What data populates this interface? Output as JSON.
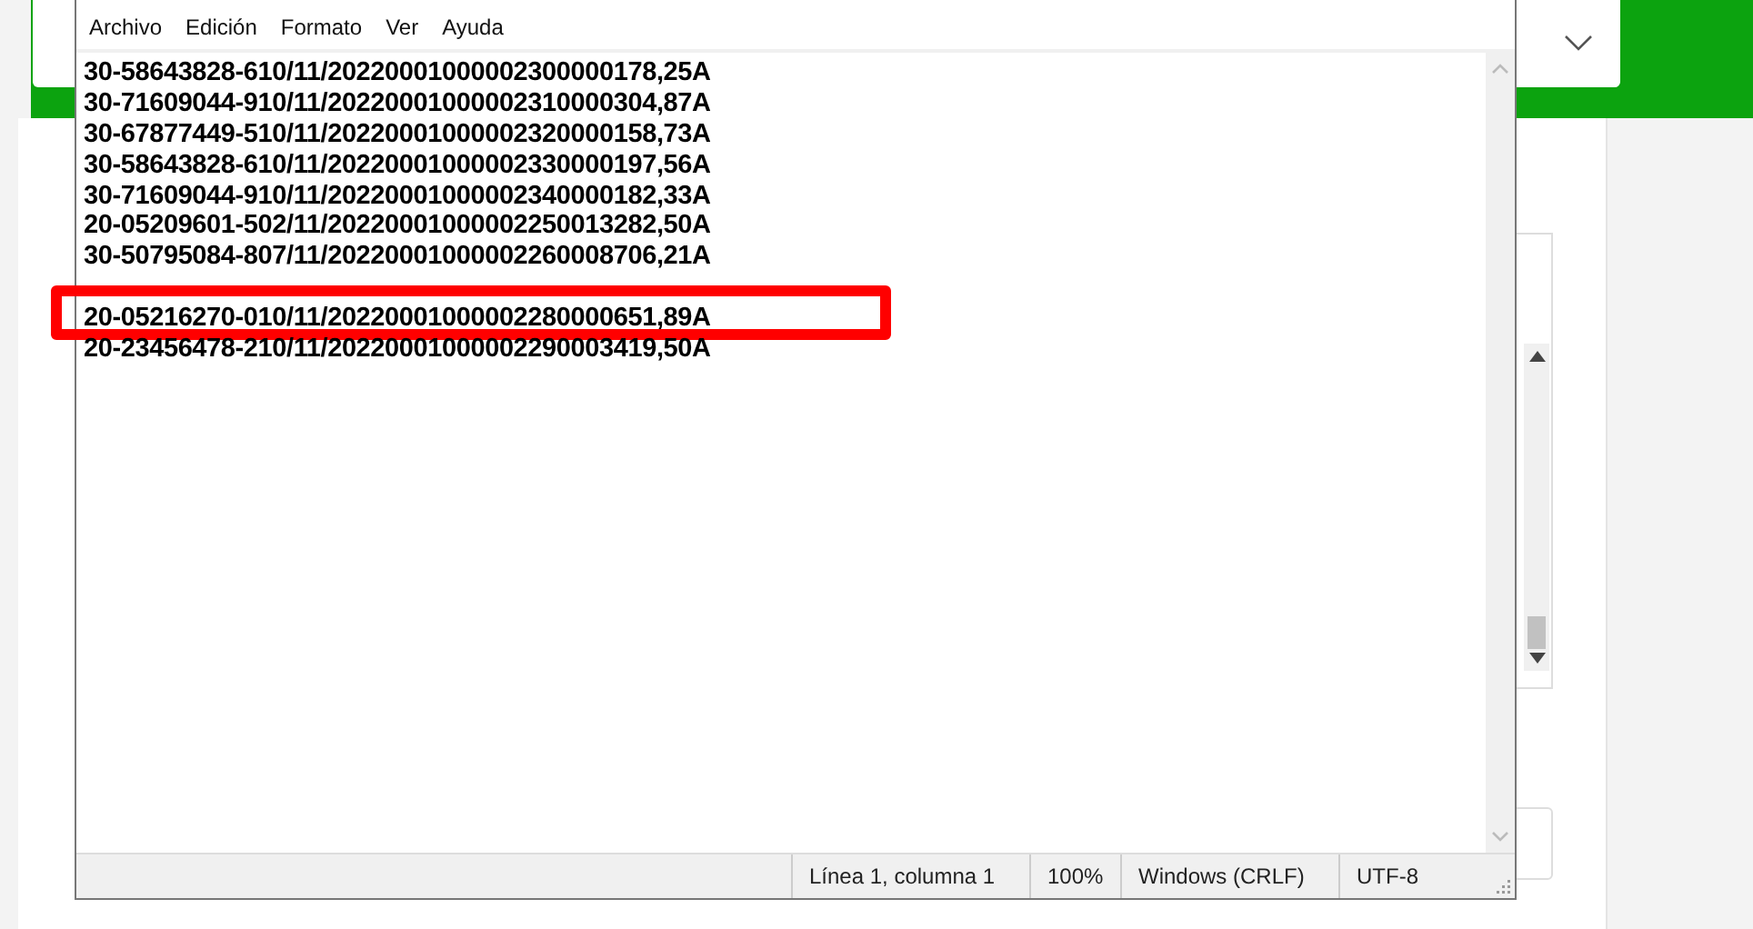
{
  "notepad": {
    "menu": [
      "Archivo",
      "Edición",
      "Formato",
      "Ver",
      "Ayuda"
    ],
    "lines": [
      {
        "text": "30-58643828-610/11/20220001000002300000178,25A",
        "highlighted": false
      },
      {
        "text": "30-71609044-910/11/20220001000002310000304,87A",
        "highlighted": false
      },
      {
        "text": "30-67877449-510/11/20220001000002320000158,73A",
        "highlighted": false
      },
      {
        "text": "30-58643828-610/11/20220001000002330000197,56A",
        "highlighted": false
      },
      {
        "text": "30-71609044-910/11/20220001000002340000182,33A",
        "highlighted": false
      },
      {
        "text": "20-05209601-502/11/20220001000002250013282,50A",
        "highlighted": false
      },
      {
        "text": "30-50795084-807/11/20220001000002260008706,21A",
        "highlighted": false
      },
      {
        "text": "20-05216270-010/11/20220001000002280000651,89A",
        "highlighted": true
      },
      {
        "text": "20-23456478-210/11/20220001000002290003419,50A",
        "highlighted": false
      }
    ],
    "status_bar": [
      "Línea 1, columna 1",
      "100%",
      "Windows (CRLF)",
      "UTF-8"
    ]
  }
}
